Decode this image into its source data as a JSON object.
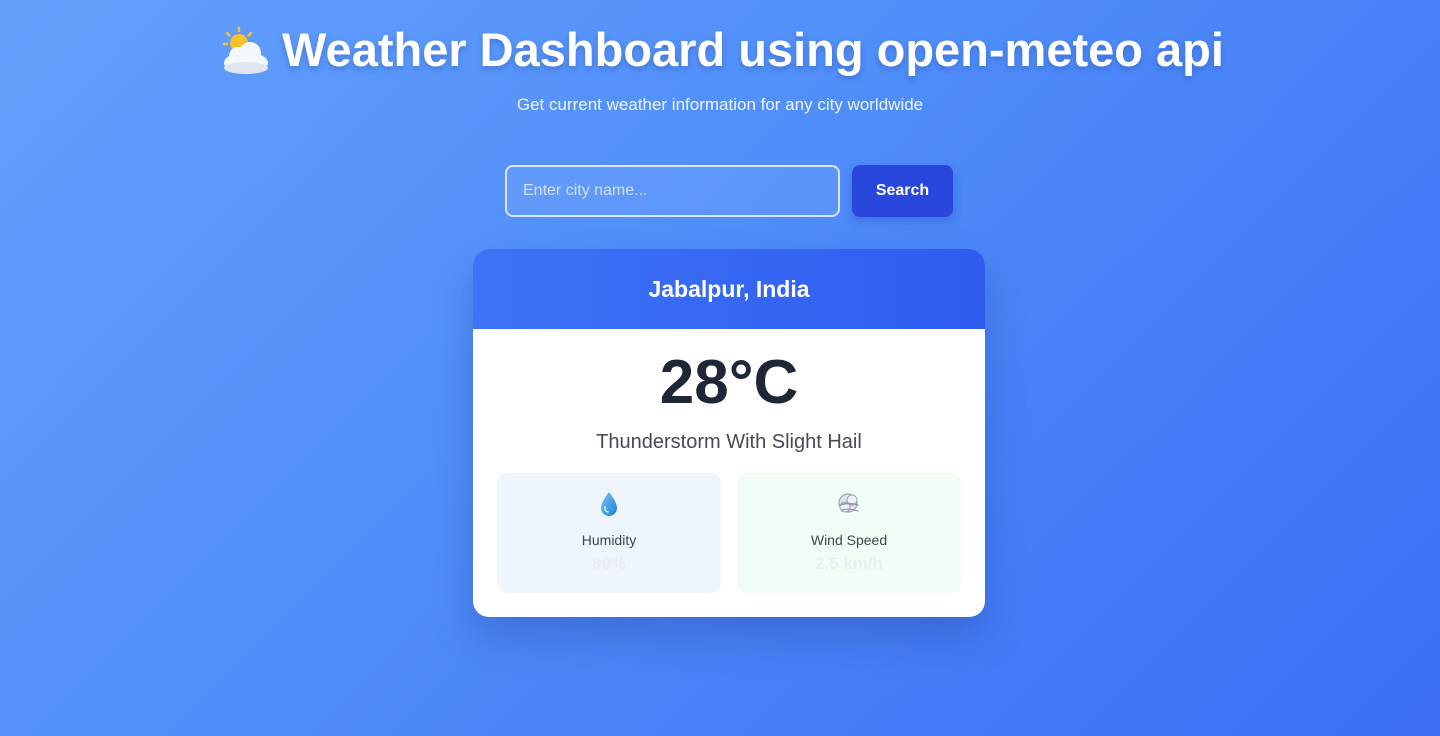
{
  "header": {
    "title": "Weather Dashboard using open-meteo api",
    "title_icon": "sun-behind-cloud-icon",
    "subtitle": "Get current weather information for any city worldwide"
  },
  "search": {
    "placeholder": "Enter city name...",
    "value": "",
    "button_label": "Search"
  },
  "weather": {
    "location": "Jabalpur, India",
    "temperature": "28°C",
    "description": "Thunderstorm With Slight Hail",
    "stats": [
      {
        "label": "Humidity",
        "value": "89%",
        "icon": "droplet-icon"
      },
      {
        "label": "Wind Speed",
        "value": "2.5 km/h",
        "icon": "wind-face-icon"
      }
    ]
  },
  "colors": {
    "background_start": "#63a0fd",
    "background_end": "#3b6ef5",
    "button": "#2946dd",
    "card_header": "#3d73f6",
    "temperature_text": "#1f2737"
  }
}
